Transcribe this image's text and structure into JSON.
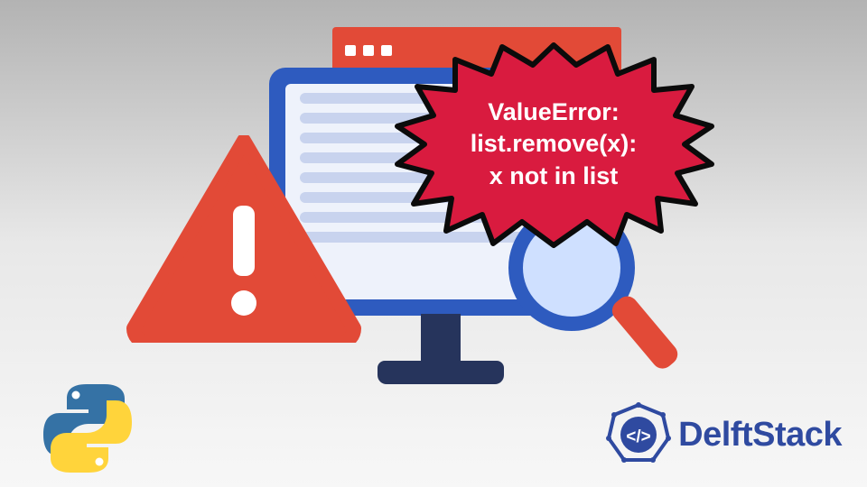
{
  "error": {
    "line1": "ValueError:",
    "line2": "list.remove(x):",
    "line3": "x not in list"
  },
  "brand": {
    "name": "DelftStack"
  },
  "icons": {
    "python": "python-logo",
    "warning": "warning-triangle",
    "magnifier": "magnifying-glass",
    "burst": "starburst-bubble",
    "brand": "delftstack-badge"
  },
  "colors": {
    "burst_fill": "#d91b3f",
    "burst_stroke": "#0b0b0b",
    "warn_fill": "#e24a37",
    "monitor_bezel": "#2e5bbf",
    "brand_text": "#2f4aa0",
    "magnify_handle": "#e24a37"
  }
}
